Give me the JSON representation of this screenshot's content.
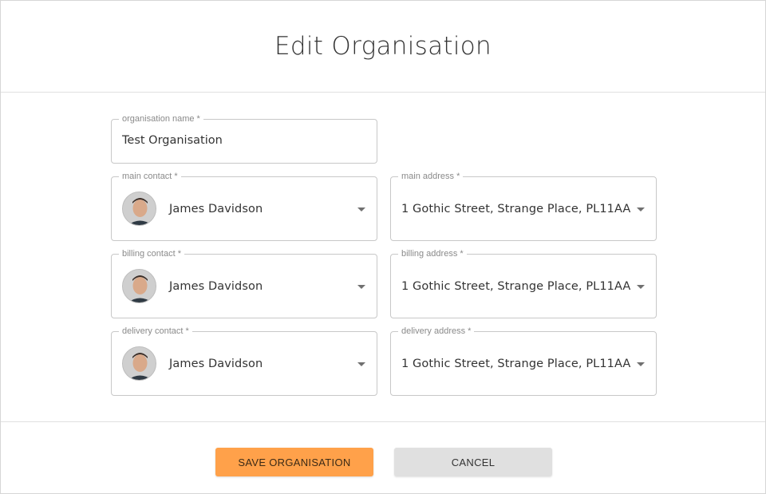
{
  "dialog": {
    "title": "Edit Organisation"
  },
  "form": {
    "organisation_name": {
      "label": "organisation name *",
      "value": "Test Organisation"
    },
    "main_contact": {
      "label": "main contact *",
      "value": "James Davidson"
    },
    "main_address": {
      "label": "main address *",
      "value": "1 Gothic Street, Strange Place, PL11AA"
    },
    "billing_contact": {
      "label": "billing contact *",
      "value": "James Davidson"
    },
    "billing_address": {
      "label": "billing address *",
      "value": "1 Gothic Street, Strange Place, PL11AA"
    },
    "delivery_contact": {
      "label": "delivery contact *",
      "value": "James Davidson"
    },
    "delivery_address": {
      "label": "delivery address *",
      "value": "1 Gothic Street, Strange Place, PL11AA"
    }
  },
  "actions": {
    "save_label": "SAVE ORGANISATION",
    "cancel_label": "CANCEL"
  },
  "colors": {
    "primary_button": "#ffa14a",
    "secondary_button": "#e0e0e0",
    "field_border": "#c8c8c8",
    "label_text": "#8a8a8a"
  },
  "icons": {
    "select_arrow": "chevron-down-icon",
    "contact_avatar": "avatar"
  }
}
